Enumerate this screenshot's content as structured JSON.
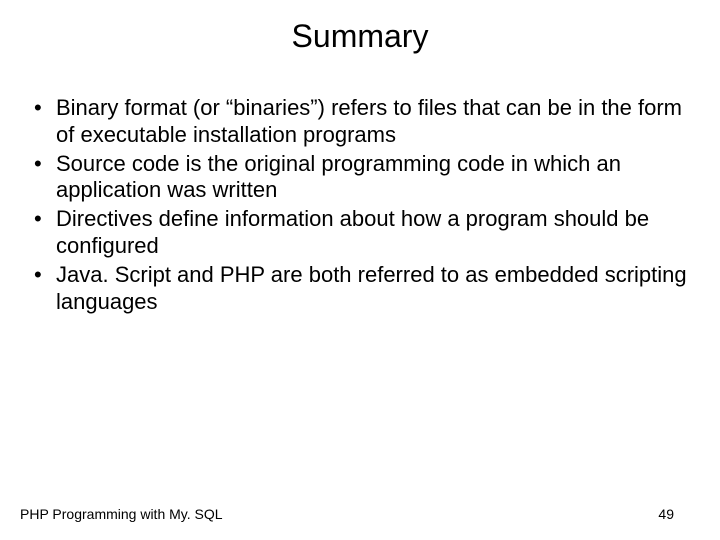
{
  "title": "Summary",
  "bullets": [
    "Binary format (or “binaries”) refers to files that can be in the form of executable installation programs",
    "Source code is the original programming code in which an application was written",
    "Directives define information about how a program should be configured",
    "Java. Script and PHP are both referred to as embedded scripting languages"
  ],
  "footer": {
    "left": "PHP Programming with My. SQL",
    "right": "49"
  }
}
